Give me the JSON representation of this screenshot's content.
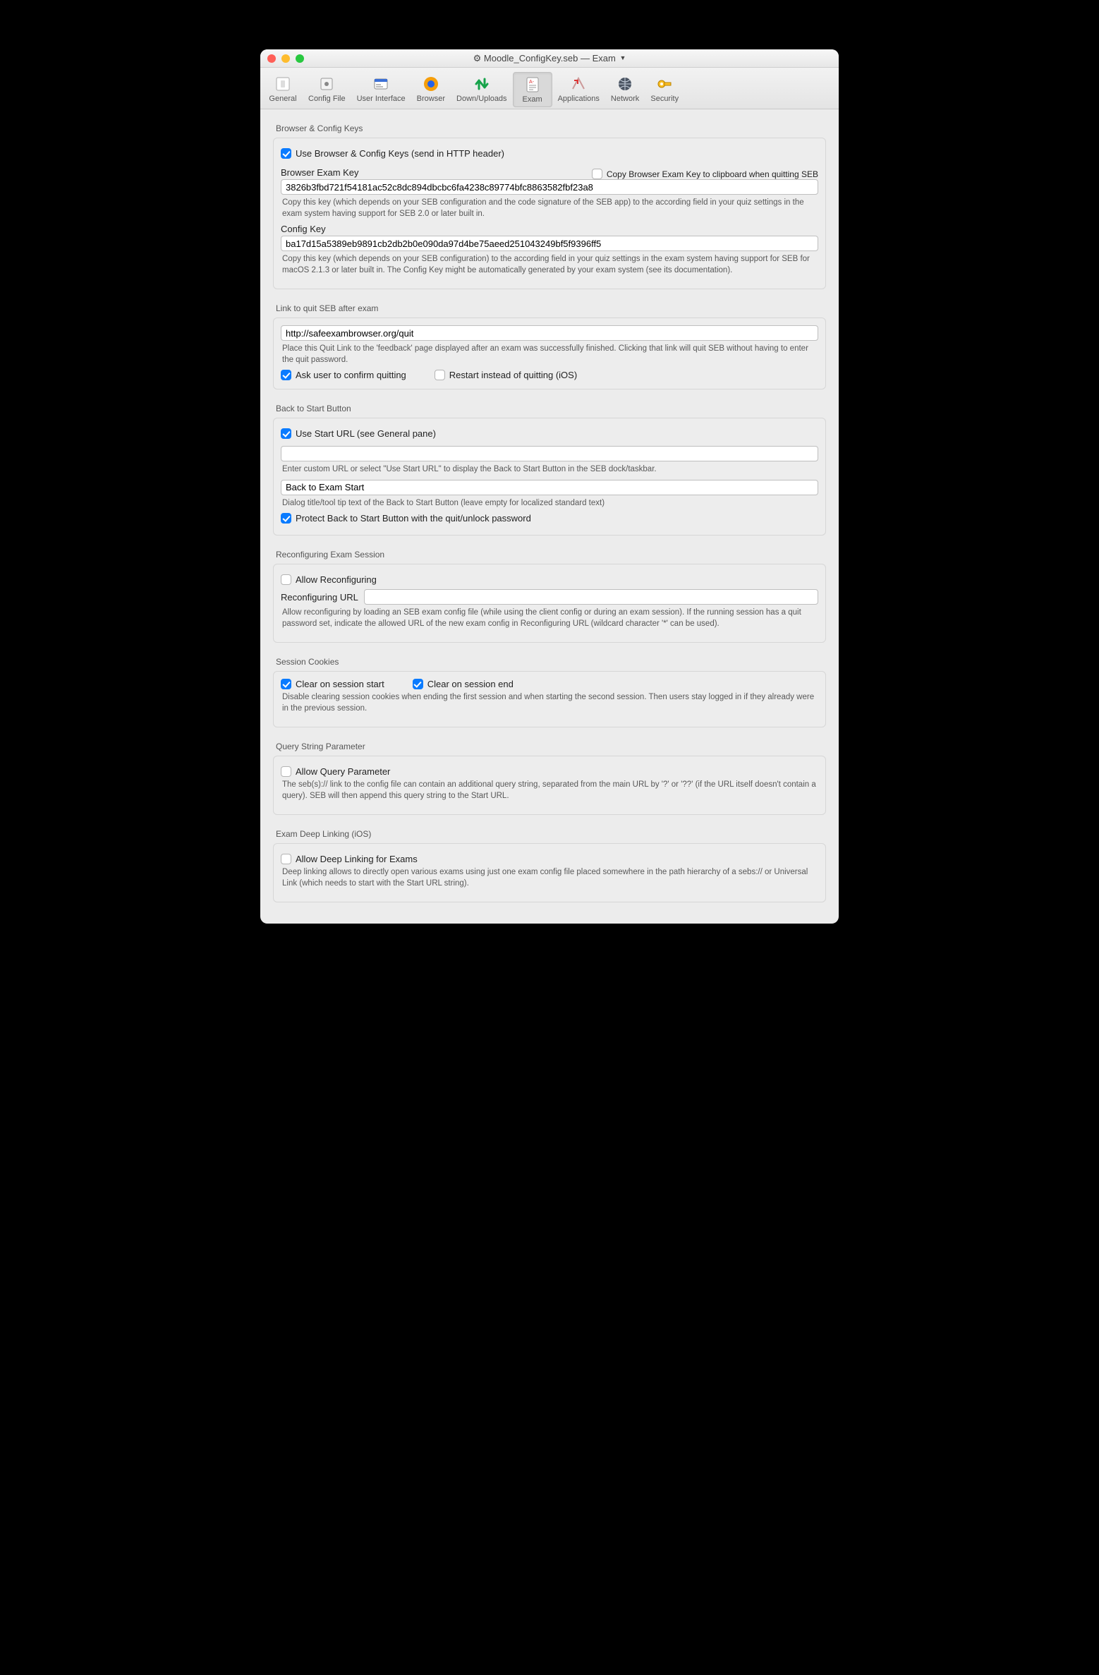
{
  "window": {
    "title_file": "Moodle_ConfigKey.seb",
    "title_sep": " — ",
    "title_tab": "Exam"
  },
  "tabs": {
    "general": "General",
    "config_file": "Config File",
    "user_interface": "User Interface",
    "browser": "Browser",
    "down_uploads": "Down/Uploads",
    "exam": "Exam",
    "applications": "Applications",
    "network": "Network",
    "security": "Security"
  },
  "s1": {
    "title": "Browser & Config Keys",
    "use_keys": "Use Browser & Config Keys (send in HTTP header)",
    "bek_label": "Browser Exam Key",
    "copy_bek": "Copy Browser Exam Key to clipboard when quitting SEB",
    "bek_value": "3826b3fbd721f54181ac52c8dc894dbcbc6fa4238c89774bfc8863582fbf23a8",
    "bek_help": "Copy this key (which depends on your SEB configuration and the code signature of the SEB app) to the according field in your quiz settings in the exam system having support for SEB 2.0 or later built in.",
    "ck_label": "Config Key",
    "ck_value": "ba17d15a5389eb9891cb2db2b0e090da97d4be75aeed251043249bf5f9396ff5",
    "ck_help": "Copy this key (which depends on your SEB configuration) to the according field in your quiz settings in the exam system having support for SEB for macOS 2.1.3 or later built in. The Config Key might be automatically generated by your exam system (see its documentation)."
  },
  "s2": {
    "title": "Link to quit SEB after exam",
    "url": "http://safeexambrowser.org/quit",
    "help": "Place this Quit Link to the 'feedback' page displayed after an exam was successfully finished. Clicking that link will quit SEB without having to enter the quit password.",
    "confirm": "Ask user to confirm quitting",
    "restart": "Restart instead of quitting (iOS)"
  },
  "s3": {
    "title": "Back to Start Button",
    "use_start": "Use Start URL (see General pane)",
    "custom_url": "",
    "url_help": "Enter custom URL or select \"Use Start URL\" to display the Back to Start Button in the SEB dock/taskbar.",
    "button_text": "Back to Exam Start",
    "text_help": "Dialog title/tool tip text of the Back to Start Button (leave empty for localized standard text)",
    "protect": "Protect Back to Start Button with the quit/unlock password"
  },
  "s4": {
    "title": "Reconfiguring Exam Session",
    "allow": "Allow Reconfiguring",
    "url_label": "Reconfiguring URL",
    "url": "",
    "help": "Allow reconfiguring by loading an SEB exam config file (while using the client config or during an exam session). If the running session has a quit password set, indicate the allowed URL of the new exam config in Reconfiguring URL (wildcard character '*' can be used)."
  },
  "s5": {
    "title": "Session Cookies",
    "clear_start": "Clear on session start",
    "clear_end": "Clear on session end",
    "help": "Disable clearing session cookies when ending the first session and when starting the second session. Then users stay logged in if they already were in the previous session."
  },
  "s6": {
    "title": "Query String Parameter",
    "allow": "Allow Query Parameter",
    "help": "The seb(s):// link to the config file can contain an additional query string, separated from the main URL by '?' or '??' (if the URL itself doesn't contain a query). SEB will then append this query string to the Start URL."
  },
  "s7": {
    "title": "Exam Deep Linking (iOS)",
    "allow": "Allow Deep Linking for Exams",
    "help": "Deep linking allows to directly open various exams using just one exam config file placed somewhere in the path hierarchy of a sebs:// or Universal Link (which needs to start with the Start URL string)."
  }
}
